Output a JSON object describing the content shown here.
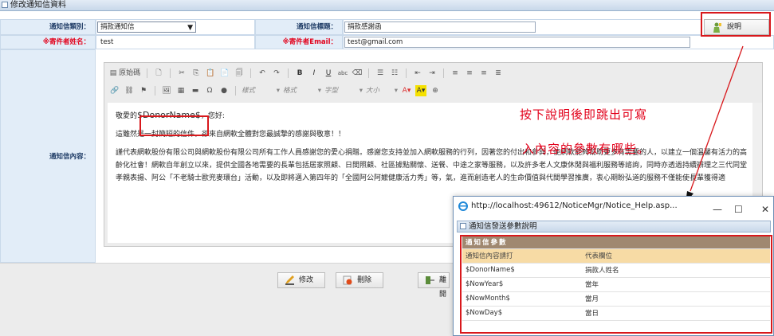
{
  "panel": {
    "title": "修改通知信資料"
  },
  "form": {
    "category_label": "通知信類別：",
    "category_value": "捐款通知信",
    "subject_label": "通知信標題：",
    "subject_value": "捐款感謝函",
    "sender_name_label": "※寄件者姓名：",
    "sender_name_value": "test",
    "sender_email_label": "※寄件者Email：",
    "sender_email_value": "test@gmail.com",
    "content_label": "通知信內容：",
    "help_button": "說明"
  },
  "editor": {
    "toolbar": {
      "source": "原始碼",
      "style_combo": "樣式",
      "format_combo": "格式",
      "font_combo": "字型",
      "size_combo": "大小"
    },
    "content": {
      "greeting_prefix": "敬愛的",
      "greeting_var": "$DonorName$",
      "greeting_suffix": "，您好:",
      "para1": "這雖然是一封簡短的信件，卻來自網軟全體對您最誠摯的感謝與敬意！！",
      "para2": "謹代表網軟股份有限公司與網軟股份有限公司所有工作人員感謝您的愛心捐贈。感謝您支持並加入網軟服務的行列，因著您的付出和參與，使網軟能夠幫助更多有需要的人，以建立一個溫馨有活力的高齡化社會！網軟自年創立以來，提供全國各地需要的長輩包括居家照顧、日間照顧、社區據點關懷、送餐、中途之家等服務，以及許多老人文康休閒與福利服務等諮詢，同時亦透過持續辦理之三代同堂孝親表揚、阿公「不老騎士歐兜麥環台」活動，以及即將邁入第四年的「全國阿公阿嬤健康活力秀」等，氣，進而創造老人的生命價值與代間學習推廣，衷心期盼弘道的服務不僅能使長輩獲得適"
    }
  },
  "annotation": {
    "line1": "按下說明後即跳出可寫",
    "line2": "入內容的參數有哪些。"
  },
  "actions": {
    "edit": "修改",
    "delete": "刪除",
    "leave": "離開"
  },
  "popup": {
    "url": "http://localhost:49612/NoticeMgr/Notice_Help.asp...",
    "minimize": "—",
    "maximize": "☐",
    "close": "✕",
    "section_title": "通知信發送參數說明",
    "table": {
      "header": "通知信參數",
      "col1": "通知信內容請打",
      "col2": "代表欄位",
      "rows": [
        {
          "param": "$DonorName$",
          "field": "捐款人姓名"
        },
        {
          "param": "$NowYear$",
          "field": "當年"
        },
        {
          "param": "$NowMonth$",
          "field": "當月"
        },
        {
          "param": "$NowDay$",
          "field": "當日"
        }
      ]
    }
  },
  "colors": {
    "label_bg": "#e2edf8",
    "label_text": "#1f3c66",
    "required_red": "#e2001a",
    "highlight_box": "#d8181c",
    "table_header": "#a08870",
    "table_subheader": "#f7dba5"
  }
}
